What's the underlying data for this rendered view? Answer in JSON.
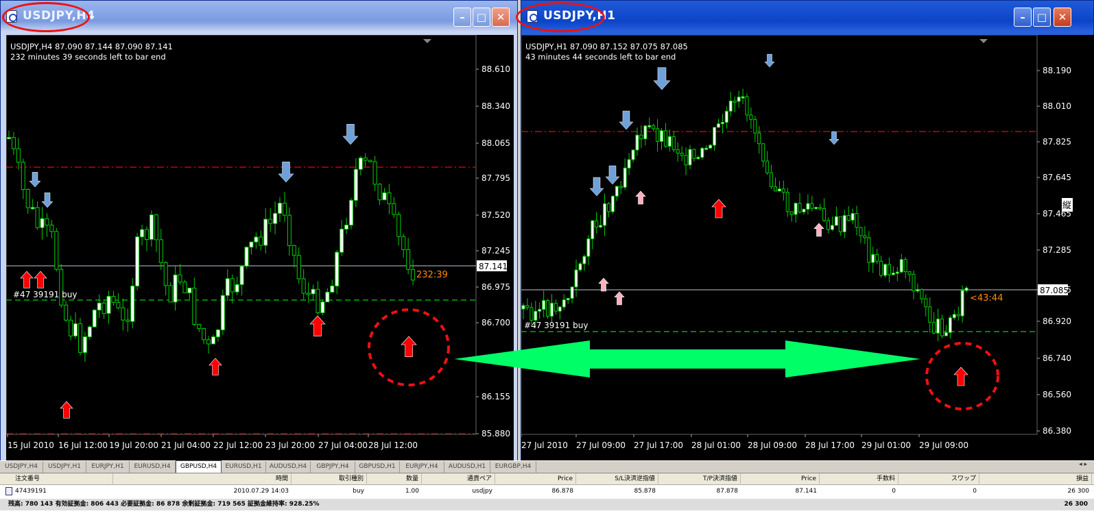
{
  "colors": {
    "bull": "#ffffff",
    "bear": "#000000",
    "wick": "#00d000",
    "upArrow": "#ff0000",
    "downArrow": "#6fa0d8",
    "tpLine": "#cc0000",
    "slLine": "#00b000",
    "price": "#9aa0a8",
    "timer": "#ff8c00",
    "doubleArrow": "#00ff66"
  },
  "left_window": {
    "title": "USDJPY,H4",
    "header_line1": "USDJPY,H4  87.090 87.144 87.090 87.141",
    "header_line2": "232 minutes 39 seconds left to bar end",
    "order_label": "#47 39191 buy",
    "timer_label": "232:39",
    "current_price": "87.141",
    "price_ticks": [
      "88.610",
      "88.340",
      "88.065",
      "87.795",
      "87.520",
      "87.245",
      "86.975",
      "86.700",
      "86.155",
      "85.880"
    ],
    "time_ticks": [
      "15 Jul 2010",
      "16 Jul 12:00",
      "19 Jul 20:00",
      "21 Jul 04:00",
      "22 Jul 12:00",
      "23 Jul 20:00",
      "27 Jul 04:00",
      "28 Jul 12:00"
    ]
  },
  "right_window": {
    "title": "USDJPY,H1",
    "header_line1": "USDJPY,H1  87.090 87.152 87.075 87.085",
    "header_line2": "43 minutes 44 seconds left to bar end",
    "order_label": "#47 39191 buy",
    "timer_label": "<43:44",
    "current_price": "87.085",
    "edge_char": "縦",
    "price_ticks": [
      "88.190",
      "88.010",
      "87.825",
      "87.645",
      "87.465",
      "87.285",
      "87.085",
      "86.920",
      "86.740",
      "86.560",
      "86.380"
    ],
    "time_ticks": [
      "27 Jul 2010",
      "27 Jul 09:00",
      "27 Jul 17:00",
      "28 Jul 01:00",
      "28 Jul 09:00",
      "28 Jul 17:00",
      "29 Jul 01:00",
      "29 Jul 09:00"
    ]
  },
  "tabs": [
    "USDJPY,H4",
    "USDJPY,H1",
    "EURJPY,H1",
    "EURUSD,H4",
    "GBPUSD,H4",
    "EURUSD,H1",
    "AUDUSD,H4",
    "GBPJPY,H4",
    "GBPUSD,H1",
    "EURJPY,H4",
    "AUDUSD,H1",
    "EURGBP,H4"
  ],
  "active_tab": "GBPUSD,H4",
  "tab_scroll": "◂ ▸",
  "terminal": {
    "headers": [
      "注文番号",
      "時間",
      "取引種別",
      "数量",
      "通貨ペア",
      "Price",
      "S/L決済逆指値",
      "T/P決済指値",
      "Price",
      "手数料",
      "スワップ",
      "損益"
    ],
    "row": [
      "47439191",
      "2010.07.29 14:03",
      "buy",
      "1.00",
      "usdjpy",
      "86.878",
      "85.878",
      "87.878",
      "87.141",
      "0",
      "0",
      "26 300"
    ],
    "summary": "残高: 780 143  有効証拠金: 806 443  必要証拠金: 86 878  余剰証拠金: 719 565  証拠金維持率: 928.25%",
    "summary_total": "26 300"
  }
}
